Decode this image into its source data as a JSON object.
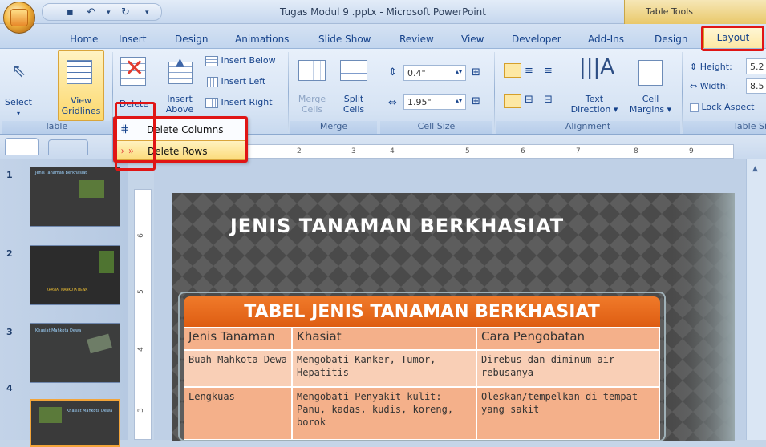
{
  "window": {
    "title": "Tugas Modul 9 .pptx - Microsoft PowerPoint",
    "context_tab_group": "Table Tools"
  },
  "tabs": [
    "Home",
    "Insert",
    "Design",
    "Animations",
    "Slide Show",
    "Review",
    "View",
    "Developer",
    "Add-Ins",
    "Design",
    "Layout"
  ],
  "ribbon": {
    "table": {
      "label": "Table",
      "select": "Select",
      "view_gridlines": [
        "View",
        "Gridlines"
      ]
    },
    "rows_columns": {
      "delete": "Delete",
      "insert_above": [
        "Insert",
        "Above"
      ],
      "insert_below": "Insert Below",
      "insert_left": "Insert Left",
      "insert_right": "Insert Right"
    },
    "merge": {
      "label": "Merge",
      "merge_cells": [
        "Merge",
        "Cells"
      ],
      "split_cells": [
        "Split",
        "Cells"
      ]
    },
    "cell_size": {
      "label": "Cell Size",
      "height": "0.4\"",
      "width": "1.95\""
    },
    "alignment": {
      "label": "Alignment",
      "text_direction": [
        "Text",
        "Direction ▾"
      ],
      "cell_margins": [
        "Cell",
        "Margins ▾"
      ]
    },
    "table_size": {
      "label": "Table Si",
      "height_label": "Height:",
      "height_value": "5.2",
      "width_label": "Width:",
      "width_value": "8.5",
      "lock_aspect": "Lock Aspect"
    }
  },
  "delete_menu": {
    "items": [
      "Delete Columns",
      "Delete Rows"
    ]
  },
  "ruler_marks": [
    "2",
    "3",
    "4",
    "5",
    "6",
    "7",
    "8",
    "9"
  ],
  "vruler_marks": [
    "6",
    "5",
    "4",
    "3"
  ],
  "slides": {
    "numbers": [
      "1",
      "2",
      "3",
      "4"
    ],
    "thumb_titles": [
      "Jenis Tanaman Berkhasiat",
      "KHASIAT MAHKOTA DEWA",
      "Khasiat Mahkota Dewa",
      "Khasiat Mahkota Dewa"
    ]
  },
  "slide": {
    "title": "JENIS TANAMAN BERKHASIAT",
    "table_title": "TABEL JENIS TANAMAN BERKHASIAT",
    "headers": [
      "Jenis Tanaman",
      "Khasiat",
      "Cara Pengobatan"
    ],
    "rows": [
      [
        "Buah Mahkota Dewa",
        "Mengobati Kanker, Tumor, Hepatitis",
        "Direbus dan diminum air rebusanya"
      ],
      [
        "Lengkuas",
        "Mengobati Penyakit kulit: Panu, kadas, kudis, koreng, borok",
        "Oleskan/tempelkan di tempat yang sakit"
      ]
    ]
  },
  "colors": {
    "accent": "#e01515",
    "table_header": "#e8681c",
    "table_body": "#f4b08a"
  }
}
